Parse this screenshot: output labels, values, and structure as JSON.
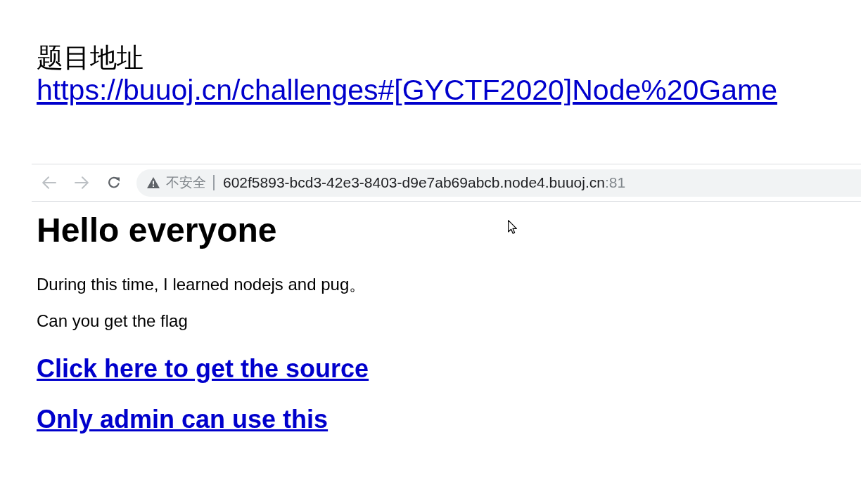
{
  "heading": {
    "title": "题目地址",
    "link": "https://buuoj.cn/challenges#[GYCTF2020]Node%20Game"
  },
  "browser": {
    "nav_buttons": [
      {
        "kind": "back",
        "disabled": true
      },
      {
        "kind": "forward",
        "disabled": true
      },
      {
        "kind": "reload",
        "disabled": false
      }
    ],
    "address_bar": {
      "security_label": "不安全",
      "host": "602f5893-bcd3-42e3-8403-d9e7ab69abcb.node4.buuoj.cn",
      "port": ":81"
    }
  },
  "page": {
    "title": "Hello everyone",
    "paragraphs": [
      "During this time, I learned nodejs and pug。",
      "Can you get the flag"
    ],
    "links": [
      "Click here to get the source",
      "Only admin can use this"
    ]
  }
}
